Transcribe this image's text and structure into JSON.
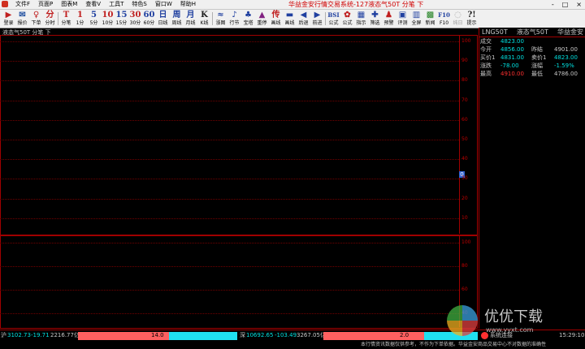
{
  "menubar": {
    "items": [
      "文件F",
      "页面P",
      "图表M",
      "查看V",
      "工具T",
      "特色S",
      "窗口W",
      "帮助H"
    ],
    "title": "华益金安行情交易系统-127液态气50T 分笔 下",
    "win": [
      "-",
      "□",
      "×"
    ]
  },
  "toolbar": [
    {
      "icon": "▶",
      "label": "登录",
      "name": "login",
      "color": "#c02020"
    },
    {
      "icon": "✉",
      "label": "报价",
      "name": "quote",
      "color": "#2050a0"
    },
    {
      "icon": "♀",
      "label": "下单",
      "name": "order",
      "color": "#c02020"
    },
    {
      "icon": "分",
      "label": "分时",
      "name": "timeshare",
      "color": "#c02020"
    },
    {
      "icon": "T",
      "label": "分笔",
      "name": "tick",
      "color": "#c02020"
    },
    {
      "icon": "1",
      "label": "1分",
      "name": "1min",
      "color": "#c02020"
    },
    {
      "icon": "5",
      "label": "5分",
      "name": "5min",
      "color": "#2040a0"
    },
    {
      "icon": "10",
      "label": "10分",
      "name": "10min",
      "color": "#c02020"
    },
    {
      "icon": "15",
      "label": "15分",
      "name": "15min",
      "color": "#2040a0"
    },
    {
      "icon": "30",
      "label": "30分",
      "name": "30min",
      "color": "#c02020"
    },
    {
      "icon": "60",
      "label": "60分",
      "name": "60min",
      "color": "#2040a0"
    },
    {
      "icon": "日",
      "label": "日线",
      "name": "daily",
      "color": "#2040a0"
    },
    {
      "icon": "周",
      "label": "周线",
      "name": "weekly",
      "color": "#2040a0"
    },
    {
      "icon": "月",
      "label": "月线",
      "name": "monthly",
      "color": "#2040a0"
    },
    {
      "icon": "K",
      "label": "K线",
      "name": "kline",
      "color": "#202020"
    },
    {
      "icon": "≈",
      "label": "涨图",
      "name": "chart",
      "color": "#2040a0"
    },
    {
      "icon": "♪",
      "label": "行节",
      "name": "section",
      "color": "#2040a0"
    },
    {
      "icon": "♣",
      "label": "宝塔",
      "name": "tower",
      "color": "#2040a0"
    },
    {
      "icon": "▲",
      "label": "重停",
      "name": "halt",
      "color": "#802080"
    },
    {
      "icon": "传",
      "label": "画线",
      "name": "drawline",
      "color": "#c02020"
    },
    {
      "icon": "▬",
      "label": "画线",
      "name": "drawline2",
      "color": "#2040a0"
    },
    {
      "icon": "◀",
      "label": "后退",
      "name": "back",
      "color": "#2040a0"
    },
    {
      "icon": "▶",
      "label": "前进",
      "name": "forward",
      "color": "#2040a0"
    },
    {
      "icon": "BSI",
      "label": "公式",
      "name": "formula",
      "color": "#2040a0"
    },
    {
      "icon": "✿",
      "label": "公式",
      "name": "formula2",
      "color": "#c02020"
    },
    {
      "icon": "▦",
      "label": "指示",
      "name": "indicator",
      "color": "#2040a0"
    },
    {
      "icon": "✚",
      "label": "筛选",
      "name": "screen",
      "color": "#2040a0"
    },
    {
      "icon": "♟",
      "label": "预警",
      "name": "alert",
      "color": "#c02020"
    },
    {
      "icon": "▣",
      "label": "评测",
      "name": "evaluate",
      "color": "#2040a0"
    },
    {
      "icon": "▥",
      "label": "全屏",
      "name": "fullscreen",
      "color": "#2040a0"
    },
    {
      "icon": "▩",
      "label": "新闻",
      "name": "news",
      "color": "#208020"
    },
    {
      "icon": "F10",
      "label": "F10",
      "name": "f10",
      "color": "#2040a0"
    },
    {
      "icon": "◌",
      "label": "纯日",
      "name": "pureday",
      "color": "#a0a0a0",
      "disabled": true
    },
    {
      "icon": "?!",
      "label": "提示",
      "name": "tips",
      "color": "#202020"
    }
  ],
  "chart_title": "液态气50T 分笔 下",
  "yaxis_top": [
    "100",
    "90",
    "80",
    "70",
    "60",
    "50",
    "40",
    "30",
    "20",
    "10"
  ],
  "yaxis_bottom": [
    "100",
    "80",
    "60",
    "40"
  ],
  "marker": "0",
  "panel": {
    "code": "LNG50T",
    "name": "液态气50T",
    "company": "华益金安",
    "rows": [
      {
        "l1": "成交",
        "v1": "4823.00",
        "c1": "#00e0e0",
        "l2": "",
        "v2": "",
        "c2": "#c8c8c8"
      },
      {
        "l1": "今开",
        "v1": "4856.00",
        "c1": "#00e0e0",
        "l2": "昨结",
        "v2": "4901.00",
        "c2": "#c8c8c8"
      },
      {
        "l1": "买价1",
        "v1": "4831.00",
        "c1": "#00e0e0",
        "l2": "卖价1",
        "v2": "4823.00",
        "c2": "#00e0e0"
      },
      {
        "l1": "涨跌",
        "v1": "-78.00",
        "c1": "#00e0e0",
        "l2": "涨幅",
        "v2": "-1.59%",
        "c2": "#00e0e0"
      },
      {
        "l1": "最高",
        "v1": "4910.00",
        "c1": "#ff3030",
        "l2": "最低",
        "v2": "4786.00",
        "c2": "#c8c8c8"
      }
    ]
  },
  "status": {
    "sh_label": "沪",
    "sh_value": "3102.73",
    "sh_change": "-19.71",
    "sh_amount": "2216.77亿",
    "sh_bar": "14.0",
    "sz_label": "深",
    "sz_value": "10692.65",
    "sz_change": "-103.49",
    "sz_amount": "3267.05亿",
    "sz_bar": "2.0",
    "conn": "系统连接",
    "time": "15:29:10"
  },
  "bottom": {
    "notice": "本行情资讯数据仅供参考，不作为下单依据。华益金安商品交易中心不对数据的准确性"
  },
  "watermark": {
    "text": "优优下载",
    "url": "www.yyxt.com"
  }
}
